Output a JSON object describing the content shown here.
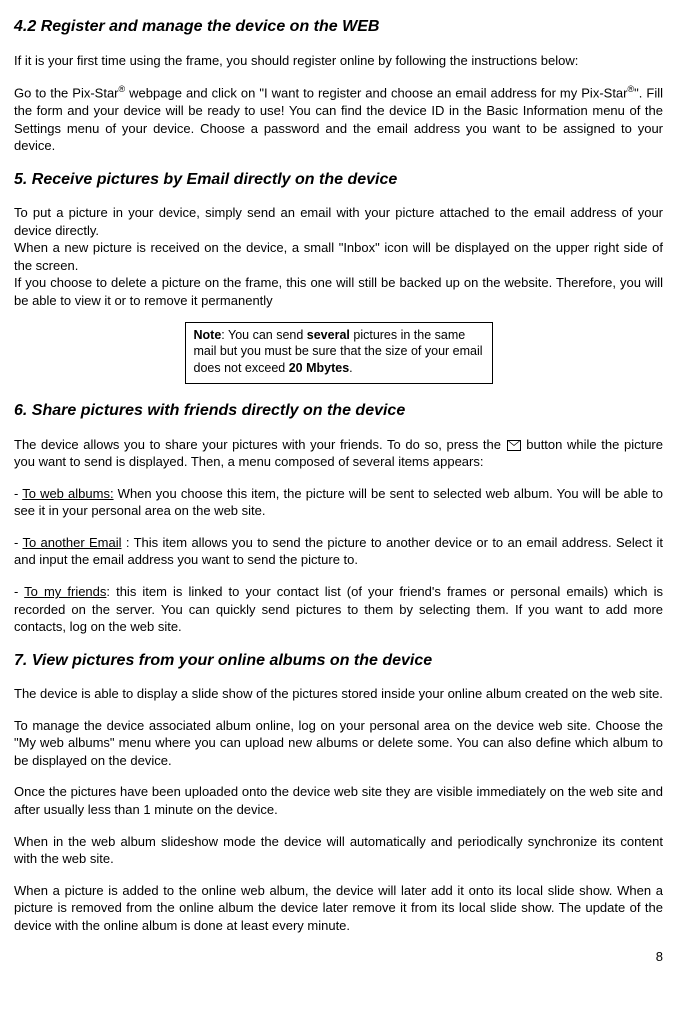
{
  "s42": {
    "heading": "4.2 Register and manage the device on the WEB",
    "p1": "If it is your first time using the frame, you should register online by following the instructions below:",
    "p2a": "Go to the Pix-Star",
    "p2b": " webpage and click on \"I want to register and choose an email address for my Pix-Star",
    "p2c": "\". Fill the form and your device will be ready to use! You can find the device ID in the Basic Information menu of the Settings menu of your device. Choose a password and the email address you want to be assigned to your device."
  },
  "s5": {
    "heading": "5. Receive pictures by Email directly on the device",
    "p1": "To put a picture in your device, simply send an email with your picture attached to the email address of your device directly.",
    "p2": "When a new picture is received on the device, a small \"Inbox\" icon will be displayed on the upper right side of the screen.",
    "p3": "If you choose to delete a picture on the frame, this one will still be backed up on the website. Therefore, you will be able to view it or to remove it permanently",
    "note_a": "Note",
    "note_b": ": You can send ",
    "note_c": "several",
    "note_d": " pictures in the same mail but you must be sure that the size of your email does not exceed ",
    "note_e": "20 Mbytes",
    "note_f": "."
  },
  "s6": {
    "heading": "6. Share pictures with friends directly on the device",
    "p1a": "The device allows you to share your pictures with your friends. To do so, press the ",
    "p1b": " button while the picture you want to send is displayed. Then, a menu composed of several items appears:",
    "i1_label": "To web albums:",
    "i1_text": " When you choose this item, the picture will be sent to selected web album. You will be able to see it in your personal area on the web site.",
    "i2_label": "To another Email",
    "i2_text": " : This item allows you to send the picture to another device or to an email address. Select it and input the email address you want to send the picture to.",
    "i3_label": "To my friends",
    "i3_text": ": this item is linked to your contact list (of your friend's frames or personal emails) which is recorded on the server. You can quickly send pictures to them by selecting them. If you want to add more contacts, log on the web site."
  },
  "s7": {
    "heading": " 7. View pictures from your online albums on the device",
    "p1": "The device is able to display a slide show of the pictures stored inside your online album created on the web site.",
    "p2": "To manage the device associated album online, log on your personal area on the device web site. Choose the \"My web albums\" menu where you can upload new albums or delete some. You can also define which album to be displayed on the device.",
    "p3": "Once the pictures have been uploaded onto the device web site they are visible immediately on the web site and after usually less than 1 minute on the device.",
    "p4": "When in the web album slideshow mode the device will automatically and periodically synchronize its content with the web site.",
    "p5": "When a picture is added to the online web album, the device will later add it onto its local slide show. When a picture is removed from the online album the device later remove it from its local slide show. The update of the device with the online album is done at least every minute."
  },
  "pagenum": "8",
  "reg": "®"
}
